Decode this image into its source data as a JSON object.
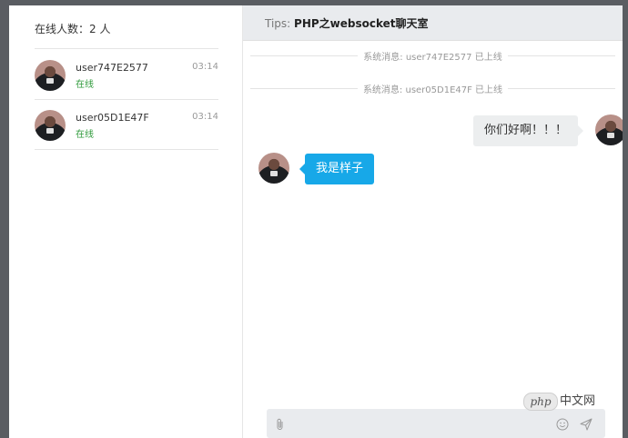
{
  "sidebar": {
    "online_count": "在线人数：2 人",
    "users": [
      {
        "name": "user747E2577",
        "status": "在线",
        "time": "03:14"
      },
      {
        "name": "user05D1E47F",
        "status": "在线",
        "time": "03:14"
      }
    ]
  },
  "chat": {
    "tips_label": "Tips: ",
    "tips_title": "PHP之websocket聊天室",
    "system_messages": [
      "系统消息: user747E2577 已上线",
      "系统消息: user05D1E47F 已上线"
    ],
    "messages": [
      {
        "side": "right",
        "text": "你们好啊！！！"
      },
      {
        "side": "left",
        "text": "我是样子"
      }
    ],
    "input": {
      "placeholder": ""
    }
  },
  "icons": {
    "attach": "paperclip-icon",
    "emoji": "smiley-icon",
    "send": "send-icon"
  },
  "watermark": {
    "badge": "php",
    "text": "中文网"
  },
  "colors": {
    "online_green": "#2e9a3a",
    "bubble_blue": "#17a8e8",
    "bubble_gray": "#eceeef",
    "header_bg": "#e9ebee"
  }
}
